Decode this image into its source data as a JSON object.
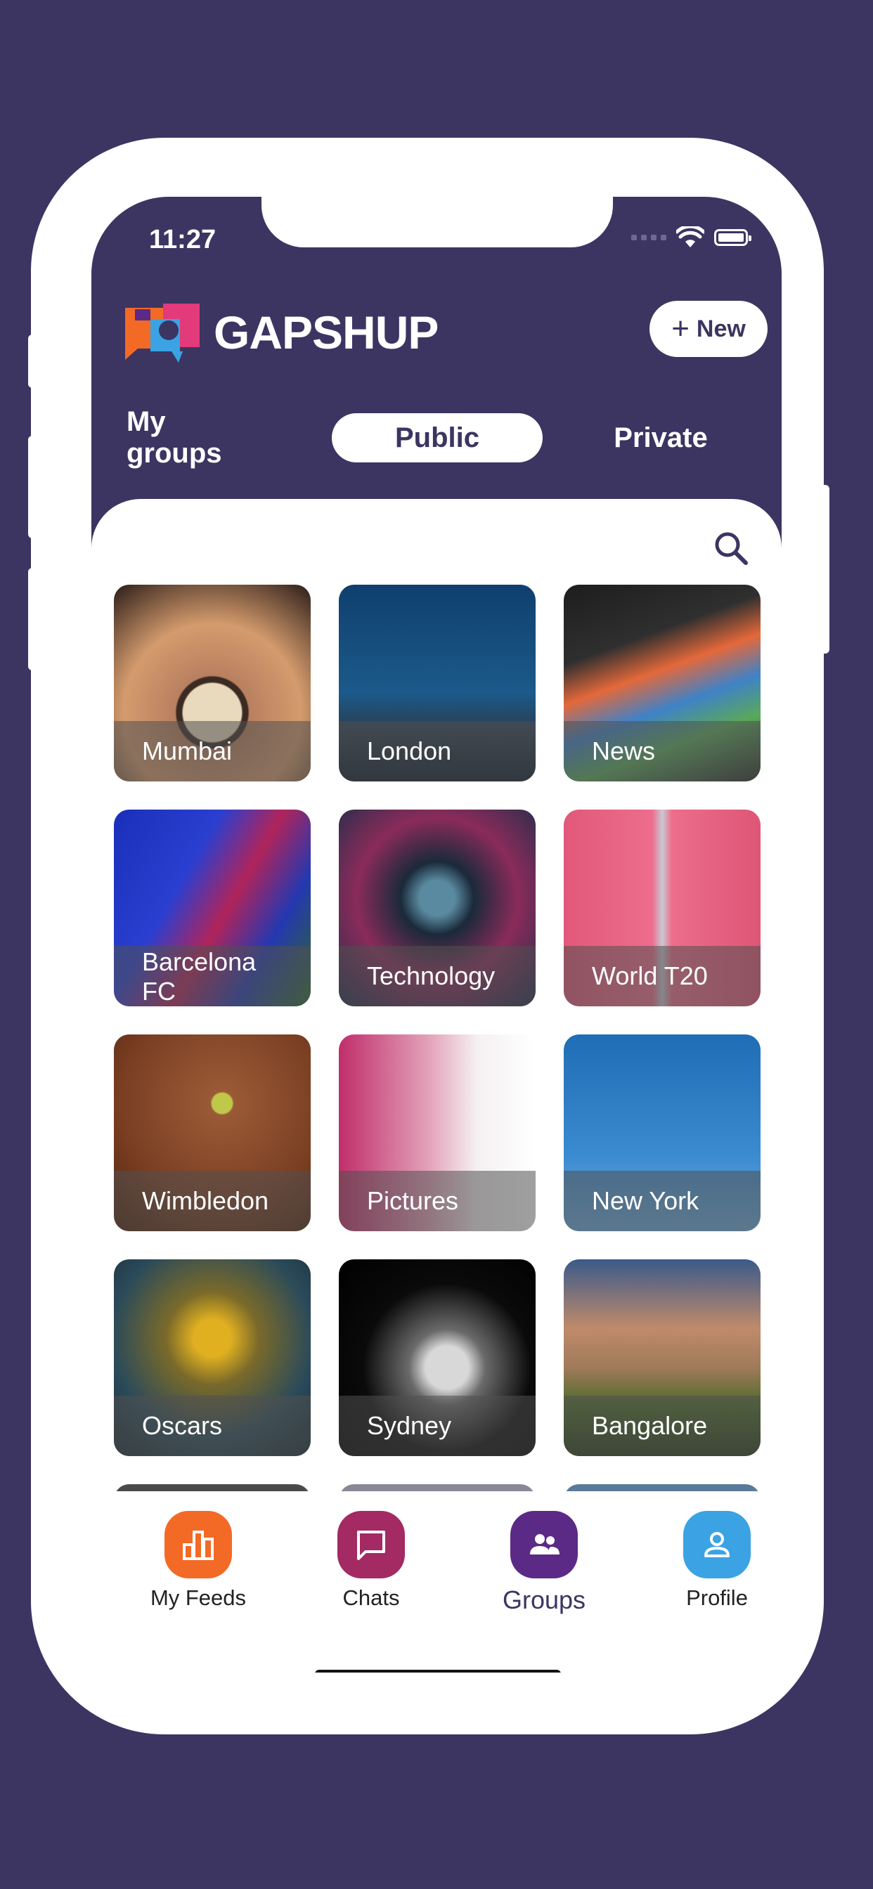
{
  "status_bar": {
    "time": "11:27"
  },
  "header": {
    "logo_text": "GAPSHUP",
    "new_button_label": "New"
  },
  "tabs": [
    {
      "label": "My groups",
      "active": false
    },
    {
      "label": "Public",
      "active": true
    },
    {
      "label": "Private",
      "active": false
    }
  ],
  "groups": [
    {
      "label": "Mumbai"
    },
    {
      "label": "London"
    },
    {
      "label": "News"
    },
    {
      "label": "Barcelona FC"
    },
    {
      "label": "Technology"
    },
    {
      "label": "World T20"
    },
    {
      "label": "Wimbledon"
    },
    {
      "label": "Pictures"
    },
    {
      "label": "New York"
    },
    {
      "label": "Oscars"
    },
    {
      "label": "Sydney"
    },
    {
      "label": "Bangalore"
    }
  ],
  "bottom_nav": [
    {
      "label": "My Feeds",
      "icon": "bar-chart-icon",
      "color": "#f26a26"
    },
    {
      "label": "Chats",
      "icon": "chat-bubble-icon",
      "color": "#a32a63"
    },
    {
      "label": "Groups",
      "icon": "group-icon",
      "color": "#5b2a86",
      "active": true
    },
    {
      "label": "Profile",
      "icon": "person-icon",
      "color": "#3ba3e3"
    }
  ],
  "colors": {
    "brand_background": "#3c3461",
    "accent_orange": "#f26a26"
  }
}
